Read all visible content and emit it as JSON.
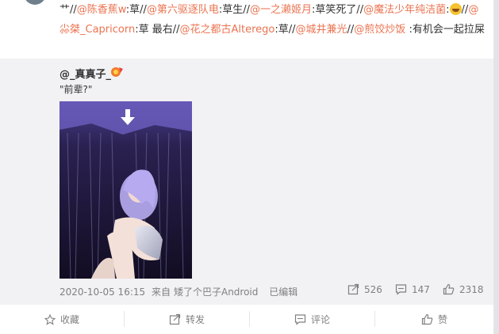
{
  "post": {
    "segments": [
      {
        "t": "艹//",
        "m": false
      },
      {
        "t": "@陈香蕉w",
        "m": true
      },
      {
        "t": ":草//",
        "m": false
      },
      {
        "t": "@第六驱逐队电",
        "m": true
      },
      {
        "t": ":草生//",
        "m": false
      },
      {
        "t": "@一之濑姬月",
        "m": true
      },
      {
        "t": ":草笑死了//",
        "m": false
      },
      {
        "t": "@魔法少年纯洁菌",
        "m": true
      },
      {
        "t": ":",
        "m": false
      },
      {
        "t": "[emoji]",
        "m": false,
        "emoji": true
      },
      {
        "t": "//",
        "m": false
      },
      {
        "t": "@尛桀_Capricorn",
        "m": true
      },
      {
        "t": ":草 最右//",
        "m": false
      },
      {
        "t": "@花之都古Alterego",
        "m": true
      },
      {
        "t": ":草//",
        "m": false
      },
      {
        "t": "@城井兼光",
        "m": true
      },
      {
        "t": "//",
        "m": false
      },
      {
        "t": "@煎饺炒饭",
        "m": true
      },
      {
        "t": " :有机会一起拉屎",
        "m": false
      }
    ]
  },
  "repost": {
    "author": "@_真真子_",
    "quote": "\"前辈?\"",
    "badge_icon": "vip-badge-icon",
    "timestamp": "2020-10-05 16:15",
    "from_label": "来自",
    "source": "矮了个巴子Android",
    "edited": "已编辑",
    "stats": {
      "forward_count": "526",
      "comment_count": "147",
      "like_count": "2318"
    }
  },
  "actions": {
    "favorite": "收藏",
    "forward": "转发",
    "comment": "评论",
    "like": "赞"
  },
  "colors": {
    "mention": "#eb7350",
    "repost_bg": "#f2f2f5",
    "muted": "#808080",
    "text": "#333333"
  }
}
